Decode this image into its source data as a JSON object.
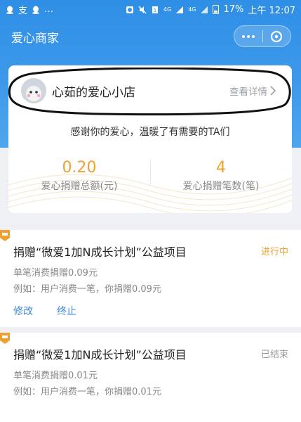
{
  "status_bar": {
    "left_text": "…",
    "left_glyph": "支",
    "network": "4G",
    "network2": "4G",
    "battery_percent": "17%",
    "clock": "上午 12:07"
  },
  "titlebar": {
    "title": "爱心商家",
    "more_icon": "more-dots-icon",
    "close_icon": "mini-program-close-icon"
  },
  "store": {
    "name": "心茹的爱心小店",
    "detail_link": "查看详情",
    "thanks": "感谢你的爱心，温暖了有需要的TA们",
    "stats": [
      {
        "value": "0.20",
        "label": "爱心捐赠总额(元)"
      },
      {
        "value": "4",
        "label": "爱心捐赠笔数(笔)"
      }
    ]
  },
  "projects": [
    {
      "title": "捐赠“微爱1加N成长计划”公益项目",
      "status": "进行中",
      "per_purchase": "单笔消费捐赠0.09元",
      "example": "例如：用户消费一笔，你捐赠0.09元",
      "actions": [
        "修改",
        "终止"
      ]
    },
    {
      "title": "捐赠“微爱1加N成长计划”公益项目",
      "status": "已结束",
      "per_purchase": "单笔消费捐赠0.01元",
      "example": "例如：用户消费一笔，你捐赠0.01元"
    }
  ],
  "colors": {
    "header_blue": "#2f8fe6",
    "accent_orange": "#f0a030",
    "link_blue": "#3a86d8"
  }
}
